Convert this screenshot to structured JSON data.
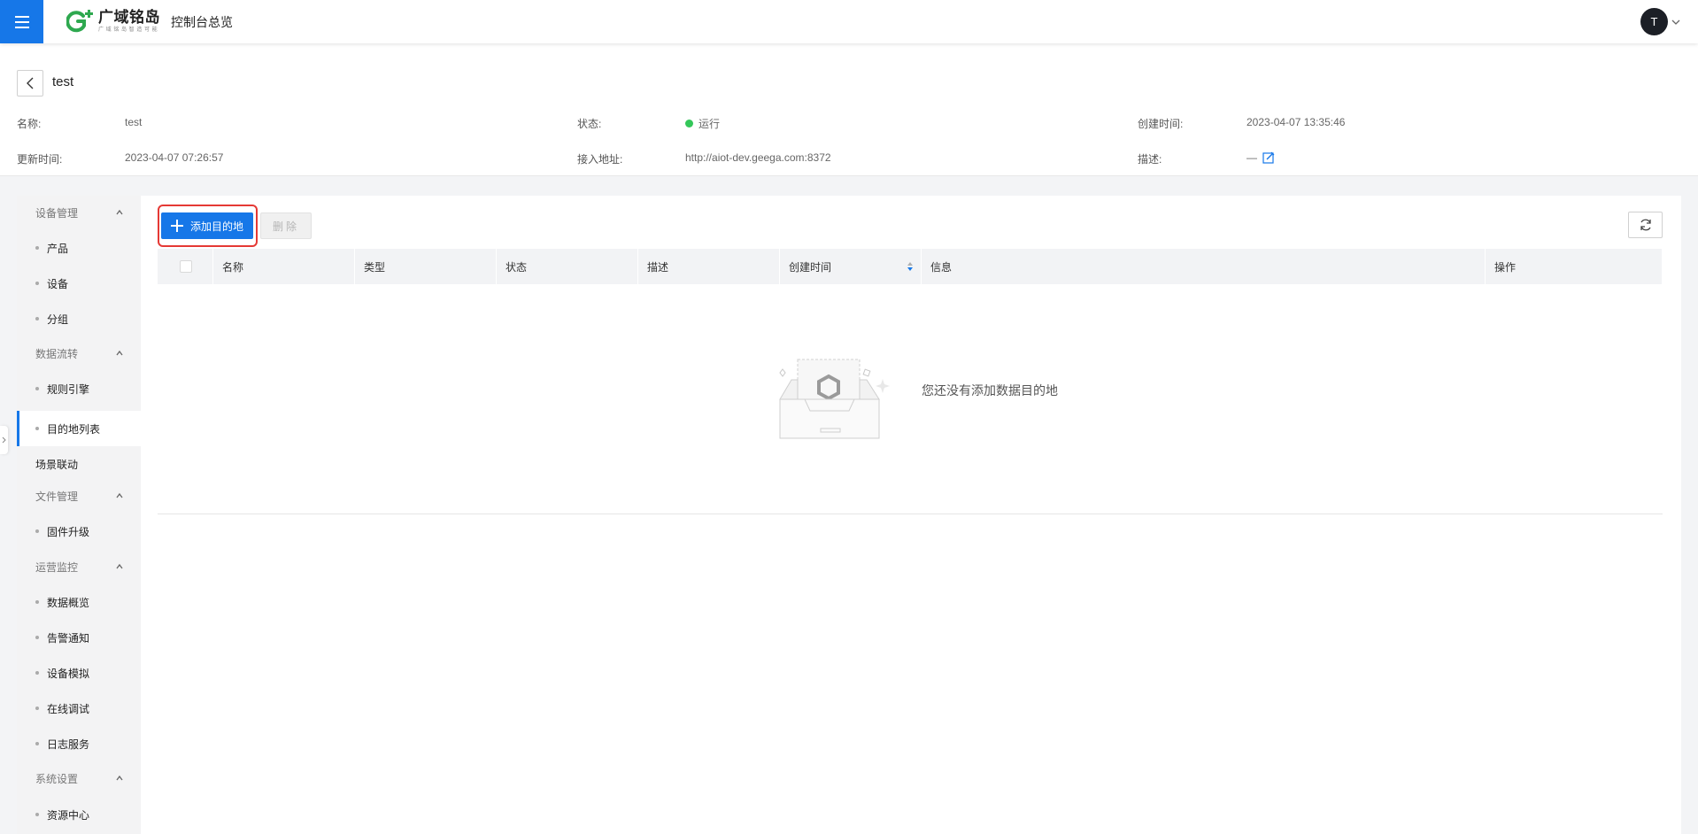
{
  "topbar": {
    "logo_name": "广域铭岛",
    "logo_slogan": "广 域 铭 岛   智 造 可 能",
    "console_title": "控制台总览",
    "avatar_initial": "T"
  },
  "header": {
    "page_title": "test",
    "fields": {
      "name_label": "名称:",
      "name_value": "test",
      "status_label": "状态:",
      "status_value": "运行",
      "status_color": "#34c759",
      "created_label": "创建时间:",
      "created_value": "2023-04-07 13:35:46",
      "updated_label": "更新时间:",
      "updated_value": "2023-04-07 07:26:57",
      "endpoint_label": "接入地址:",
      "endpoint_value": "http://aiot-dev.geega.com:8372",
      "desc_label": "描述:",
      "desc_value": "—"
    }
  },
  "sidebar": {
    "group_device": "设备管理",
    "item_product": "产品",
    "item_device": "设备",
    "item_group": "分组",
    "group_data": "数据流转",
    "item_rule": "规则引擎",
    "item_destination": "目的地列表",
    "item_scene": "场景联动",
    "group_file": "文件管理",
    "item_firmware": "固件升级",
    "group_ops": "运营监控",
    "item_overview": "数据概览",
    "item_alarm": "告警通知",
    "item_simulate": "设备模拟",
    "item_debug": "在线调试",
    "item_log": "日志服务",
    "group_system": "系统设置",
    "item_resource": "资源中心"
  },
  "toolbar": {
    "add_label": "添加目的地",
    "delete_label": "删除"
  },
  "table": {
    "columns": {
      "name": "名称",
      "type": "类型",
      "status": "状态",
      "desc": "描述",
      "created": "创建时间",
      "info": "信息",
      "action": "操作"
    }
  },
  "empty": {
    "message": "您还没有添加数据目的地"
  },
  "colors": {
    "accent": "#1677e8",
    "highlight": "#e53935"
  }
}
